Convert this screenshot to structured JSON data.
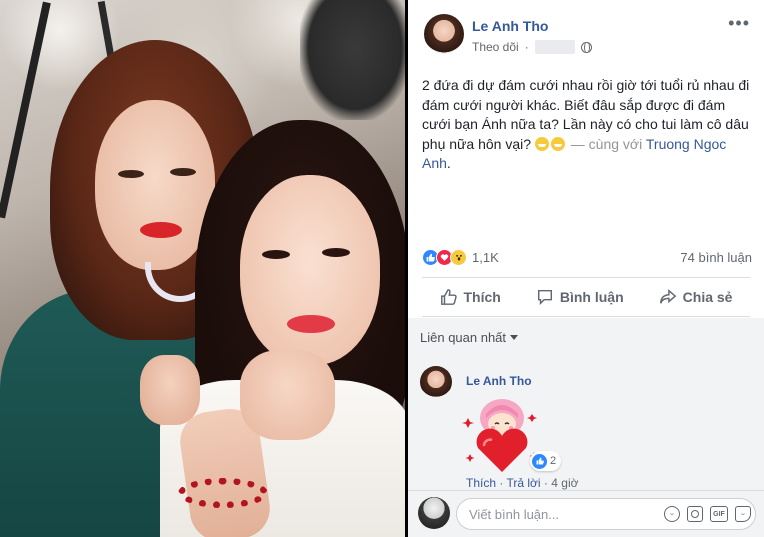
{
  "post": {
    "author": "Le Anh Tho",
    "follow_label": "Theo dõi",
    "more_label": "•••",
    "text_main": "2 đứa đi dự đám cưới nhau rồi giờ tới tuổi rủ nhau đi đám cưới người khác. Biết đâu sắp được đi đám cưới bạn Ánh nữa ta? Lần này có cho tui làm cô dâu phụ nữa hôn vại?",
    "with_label": "— cùng với",
    "tagged": "Truong Ngoc Anh",
    "punct": "."
  },
  "stats": {
    "reaction_count": "1,1K",
    "comment_count": "74 bình luận"
  },
  "actions": {
    "like": "Thích",
    "comment": "Bình luận",
    "share": "Chia sẻ"
  },
  "comments": {
    "sort_label": "Liên quan nhất",
    "items": [
      {
        "author": "Le Anh Tho",
        "reaction_count": "2",
        "like_link": "Thích",
        "reply_link": "Trả lời",
        "time": "4 giờ"
      }
    ],
    "write_placeholder": "Viết bình luận..."
  },
  "colors": {
    "link": "#365899",
    "like": "#2d88ff",
    "love": "#f0284a",
    "wow": "#f7c93c"
  },
  "icons": [
    "like-reaction-icon",
    "love-reaction-icon",
    "wow-reaction-icon",
    "thumbs-up-icon",
    "comment-icon",
    "share-icon",
    "globe-icon",
    "smile-icon",
    "camera-icon",
    "gif-icon",
    "sticker-icon"
  ]
}
